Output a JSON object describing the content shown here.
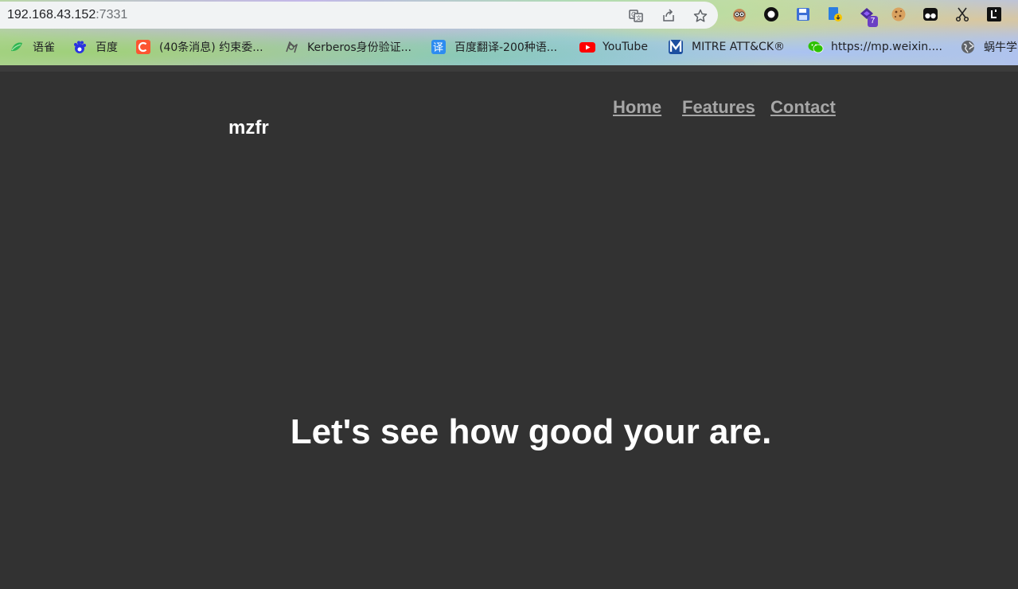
{
  "browser": {
    "url_host": "192.168.43.152",
    "url_port": ":7331",
    "toolbar_icons": [
      "translate-icon",
      "share-icon",
      "bookmark-star-icon"
    ],
    "extension_icons": [
      "owl-extension-icon",
      "circle-extension-icon",
      "save-extension-icon",
      "download-extension-icon",
      "wappalyzer-extension-icon",
      "cookie-extension-icon",
      "tampermonkey-extension-icon",
      "scissors-extension-icon",
      "letter-extension-icon"
    ],
    "extension_badge": "7",
    "bookmarks": [
      {
        "label": "语雀",
        "icon": "yuque-icon",
        "color": "#2fb553"
      },
      {
        "label": "百度",
        "icon": "baidu-icon",
        "color": "#2932e1"
      },
      {
        "label": "(40条消息) 约束委...",
        "icon": "csdn-icon",
        "color": "#fc5531"
      },
      {
        "label": "Kerberos身份验证...",
        "icon": "kerberos-icon",
        "color": "#555555"
      },
      {
        "label": "百度翻译-200种语...",
        "icon": "translate-bookmark-icon",
        "color": "#2d8cf0"
      },
      {
        "label": "YouTube",
        "icon": "youtube-icon",
        "color": "#ff0000"
      },
      {
        "label": "MITRE ATT&CK®",
        "icon": "mitre-icon",
        "color": "#1c4fa0"
      },
      {
        "label": "https://mp.weixin....",
        "icon": "wechat-icon",
        "color": "#2dc100"
      },
      {
        "label": "蜗牛学",
        "icon": "globe-icon",
        "color": "#5f6368"
      }
    ]
  },
  "site": {
    "brand": "mzfr",
    "nav": [
      "Home",
      "Features",
      "Contact"
    ],
    "hero_text": "Let's see how good your are."
  },
  "colors": {
    "page_bg": "#323232",
    "nav_link": "#a6a6a6",
    "text": "#ffffff"
  }
}
